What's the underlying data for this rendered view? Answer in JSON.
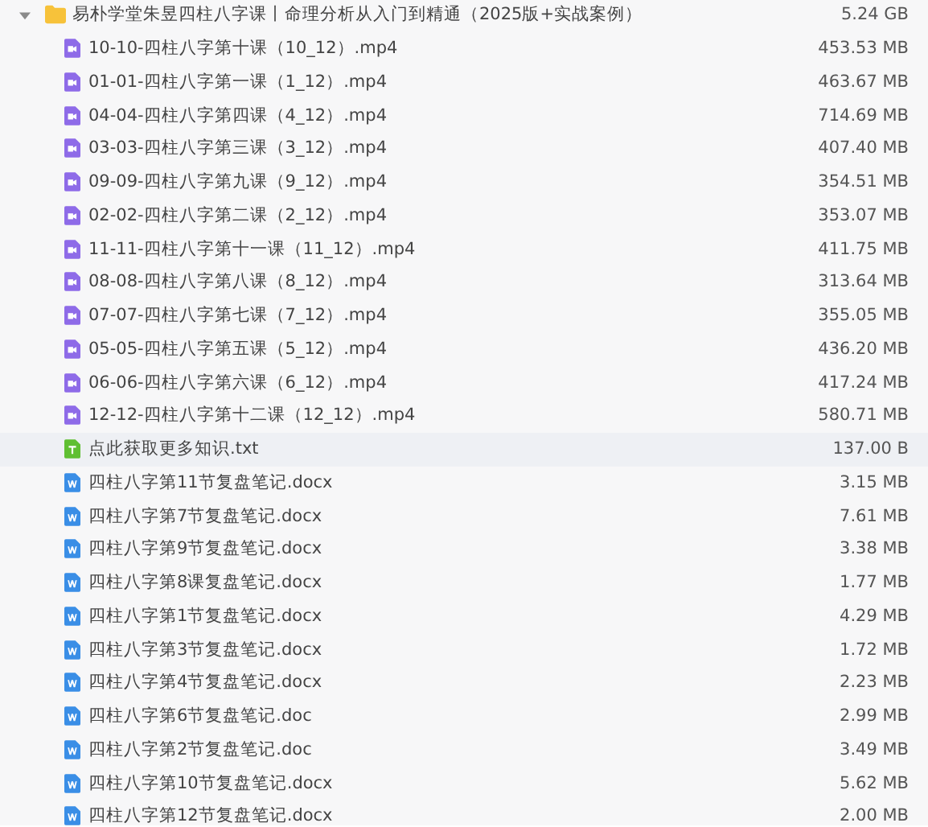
{
  "folder": {
    "name": "易朴学堂朱昱四柱八字课丨命理分析从入门到精通（2025版+实战案例）",
    "size": "5.24 GB",
    "expanded": true
  },
  "files": [
    {
      "kind": "video",
      "name": "10-10-四柱八字第十课（10_12）.mp4",
      "size": "453.53 MB",
      "highlighted": false
    },
    {
      "kind": "video",
      "name": "01-01-四柱八字第一课（1_12）.mp4",
      "size": "463.67 MB",
      "highlighted": false
    },
    {
      "kind": "video",
      "name": "04-04-四柱八字第四课（4_12）.mp4",
      "size": "714.69 MB",
      "highlighted": false
    },
    {
      "kind": "video",
      "name": "03-03-四柱八字第三课（3_12）.mp4",
      "size": "407.40 MB",
      "highlighted": false
    },
    {
      "kind": "video",
      "name": "09-09-四柱八字第九课（9_12）.mp4",
      "size": "354.51 MB",
      "highlighted": false
    },
    {
      "kind": "video",
      "name": "02-02-四柱八字第二课（2_12）.mp4",
      "size": "353.07 MB",
      "highlighted": false
    },
    {
      "kind": "video",
      "name": "11-11-四柱八字第十一课（11_12）.mp4",
      "size": "411.75 MB",
      "highlighted": false
    },
    {
      "kind": "video",
      "name": "08-08-四柱八字第八课（8_12）.mp4",
      "size": "313.64 MB",
      "highlighted": false
    },
    {
      "kind": "video",
      "name": "07-07-四柱八字第七课（7_12）.mp4",
      "size": "355.05 MB",
      "highlighted": false
    },
    {
      "kind": "video",
      "name": "05-05-四柱八字第五课（5_12）.mp4",
      "size": "436.20 MB",
      "highlighted": false
    },
    {
      "kind": "video",
      "name": "06-06-四柱八字第六课（6_12）.mp4",
      "size": "417.24 MB",
      "highlighted": false
    },
    {
      "kind": "video",
      "name": "12-12-四柱八字第十二课（12_12）.mp4",
      "size": "580.71 MB",
      "highlighted": false
    },
    {
      "kind": "text",
      "name": "点此获取更多知识.txt",
      "size": "137.00 B",
      "highlighted": true
    },
    {
      "kind": "word",
      "name": "四柱八字第11节复盘笔记.docx",
      "size": "3.15 MB",
      "highlighted": false
    },
    {
      "kind": "word",
      "name": "四柱八字第7节复盘笔记.docx",
      "size": "7.61 MB",
      "highlighted": false
    },
    {
      "kind": "word",
      "name": "四柱八字第9节复盘笔记.docx",
      "size": "3.38 MB",
      "highlighted": false
    },
    {
      "kind": "word",
      "name": "四柱八字第8课复盘笔记.docx",
      "size": "1.77 MB",
      "highlighted": false
    },
    {
      "kind": "word",
      "name": "四柱八字第1节复盘笔记.docx",
      "size": "4.29 MB",
      "highlighted": false
    },
    {
      "kind": "word",
      "name": "四柱八字第3节复盘笔记.docx",
      "size": "1.72 MB",
      "highlighted": false
    },
    {
      "kind": "word",
      "name": "四柱八字第4节复盘笔记.docx",
      "size": "2.23 MB",
      "highlighted": false
    },
    {
      "kind": "word",
      "name": "四柱八字第6节复盘笔记.doc",
      "size": "2.99 MB",
      "highlighted": false
    },
    {
      "kind": "word",
      "name": "四柱八字第2节复盘笔记.doc",
      "size": "3.49 MB",
      "highlighted": false
    },
    {
      "kind": "word",
      "name": "四柱八字第10节复盘笔记.docx",
      "size": "5.62 MB",
      "highlighted": false
    },
    {
      "kind": "word",
      "name": "四柱八字第12节复盘笔记.docx",
      "size": "2.00 MB",
      "highlighted": false
    }
  ]
}
